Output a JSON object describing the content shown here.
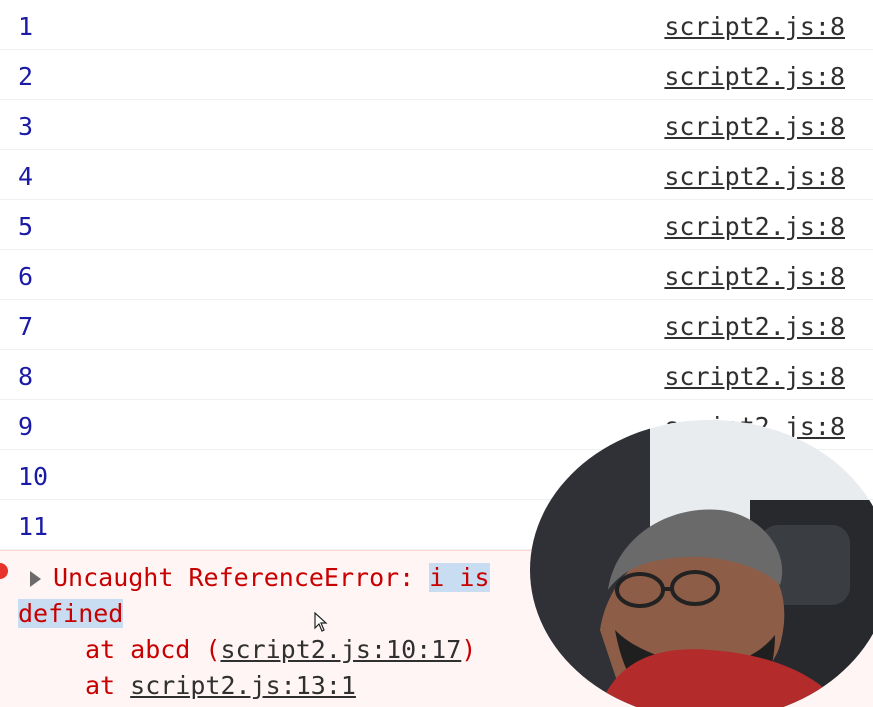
{
  "logs": [
    {
      "value": "1",
      "source": "script2.js:8"
    },
    {
      "value": "2",
      "source": "script2.js:8"
    },
    {
      "value": "3",
      "source": "script2.js:8"
    },
    {
      "value": "4",
      "source": "script2.js:8"
    },
    {
      "value": "5",
      "source": "script2.js:8"
    },
    {
      "value": "6",
      "source": "script2.js:8"
    },
    {
      "value": "7",
      "source": "script2.js:8"
    },
    {
      "value": "8",
      "source": "script2.js:8"
    },
    {
      "value": "9",
      "source": "script2.js:8"
    },
    {
      "value": "10",
      "source": ""
    },
    {
      "value": "11",
      "source": ""
    }
  ],
  "error": {
    "prefix": "Uncaught ReferenceError: ",
    "selected_part1": "i is",
    "selected_part2": "defined",
    "stack": [
      {
        "prefix": "at abcd (",
        "link": "script2.js:10:17",
        "suffix": ")"
      },
      {
        "prefix": "at ",
        "link": "script2.js:13:1",
        "suffix": ""
      }
    ]
  },
  "icons": {
    "error": "error-circle-icon",
    "expand": "expand-triangle-icon",
    "cursor": "mouse-pointer-icon"
  },
  "colors": {
    "log_value": "#1a1aa6",
    "error_text": "#c80000",
    "error_bg": "#fff5f5",
    "selection": "#c8dcf2"
  }
}
